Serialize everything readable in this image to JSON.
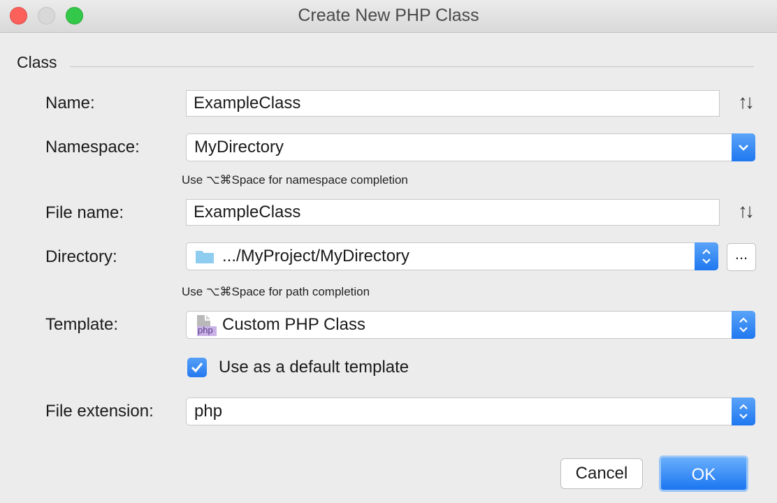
{
  "window": {
    "title": "Create New PHP Class"
  },
  "group": {
    "label": "Class"
  },
  "name": {
    "label": "Name:",
    "value": "ExampleClass"
  },
  "namespace": {
    "label": "Namespace:",
    "value": "MyDirectory",
    "hint": "Use ⌥⌘Space for namespace completion"
  },
  "file_name": {
    "label": "File name:",
    "value": "ExampleClass"
  },
  "directory": {
    "label": "Directory:",
    "value": ".../MyProject/MyDirectory",
    "hint": "Use ⌥⌘Space for path completion",
    "browse_label": "..."
  },
  "template": {
    "label": "Template:",
    "value": "Custom PHP Class",
    "icon_text": "php"
  },
  "default_template": {
    "label": "Use as a default template",
    "checked": true
  },
  "file_extension": {
    "label": "File extension:",
    "value": "php"
  },
  "swap_icon_text": "↑↓",
  "buttons": {
    "cancel": "Cancel",
    "ok": "OK"
  },
  "colors": {
    "accent": "#1f78f0",
    "folder": "#8ecdf0",
    "php_badge": "#c9b3e6"
  }
}
